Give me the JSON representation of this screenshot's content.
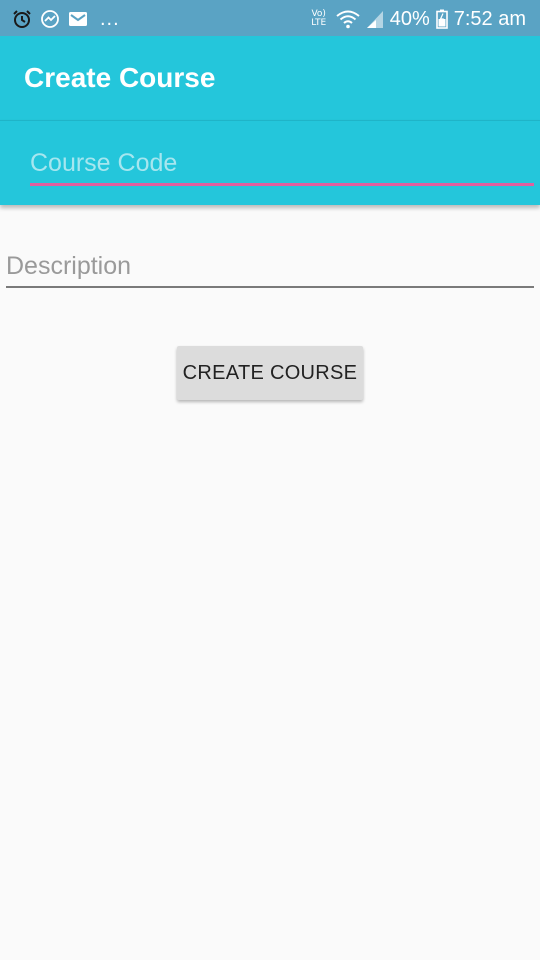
{
  "status_bar": {
    "notifications": [
      "alarm-icon",
      "messenger-icon",
      "gmail-icon"
    ],
    "more": "...",
    "network_label": "Vo) LTE",
    "battery": "40%",
    "time": "7:52 am"
  },
  "app_bar": {
    "title": "Create Course"
  },
  "form": {
    "course_code": {
      "placeholder": "Course Code",
      "value": ""
    },
    "description": {
      "placeholder": "Description",
      "value": ""
    },
    "create_button_label": "CREATE COURSE"
  },
  "colors": {
    "status_bar": "#5aa3c4",
    "primary": "#24c6db",
    "accent": "#e0609f",
    "background": "#fafafa",
    "button": "#dcdcdc"
  }
}
